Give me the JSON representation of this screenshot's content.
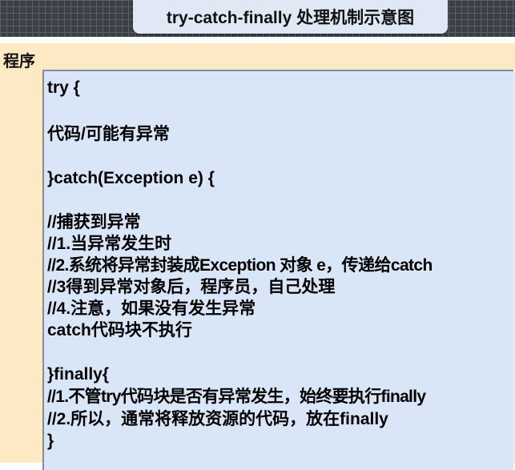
{
  "title": "try-catch-finally 处理机制示意图",
  "program_label": "程序",
  "code_lines": [
    "try {",
    "代码/可能有异常",
    "}catch(Exception e) {",
    "//捕获到异常",
    "//1.当异常发生时",
    "//2.系统将异常封装成Exception 对象 e，传递给catch",
    "//3得到异常对象后，程序员，自己处理",
    "//4.注意，如果没有发生异常",
    "catch代码块不执行",
    "}finally{",
    " //1.不管try代码块是否有异常发生，始终要执行finally",
    "//2.所以，通常将释放资源的代码，放在finally",
    "}"
  ],
  "colors": {
    "top_band": "#3b3f46",
    "title_bg": "#dfe8f4",
    "program_bg": "#fde9c4",
    "code_bg": "#d9e6f7"
  }
}
